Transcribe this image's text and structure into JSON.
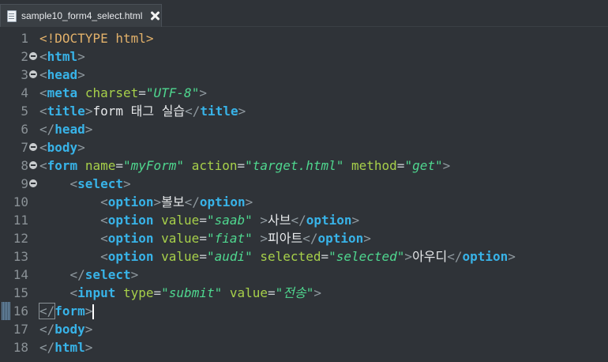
{
  "tab": {
    "filename": "sample10_form4_select.html",
    "icon": "html-file-icon",
    "close_icon": "close-icon"
  },
  "editor": {
    "current_line": 16,
    "folding_lines": [
      2,
      3,
      7,
      8,
      9
    ],
    "colors": {
      "background": "#2f3338",
      "tag": "#38b3e8",
      "attribute": "#a7d04a",
      "value": "#4fd78f",
      "doctype": "#e2b16a"
    },
    "lines": [
      {
        "number": "1",
        "tokens": [
          {
            "t": "decl",
            "v": "<!DOCTYPE html>"
          }
        ]
      },
      {
        "number": "2",
        "tokens": [
          {
            "t": "br",
            "v": "<"
          },
          {
            "t": "tag",
            "v": "html"
          },
          {
            "t": "br",
            "v": ">"
          }
        ]
      },
      {
        "number": "3",
        "tokens": [
          {
            "t": "br",
            "v": "<"
          },
          {
            "t": "tag",
            "v": "head"
          },
          {
            "t": "br",
            "v": ">"
          }
        ]
      },
      {
        "number": "4",
        "tokens": [
          {
            "t": "br",
            "v": "<"
          },
          {
            "t": "tag",
            "v": "meta"
          },
          {
            "t": "text",
            "v": " "
          },
          {
            "t": "attr",
            "v": "charset"
          },
          {
            "t": "eq",
            "v": "="
          },
          {
            "t": "val",
            "v": "\"UTF-8\""
          },
          {
            "t": "br",
            "v": ">"
          }
        ]
      },
      {
        "number": "5",
        "tokens": [
          {
            "t": "br",
            "v": "<"
          },
          {
            "t": "tag",
            "v": "title"
          },
          {
            "t": "br",
            "v": ">"
          },
          {
            "t": "text",
            "v": "form 태그 실습"
          },
          {
            "t": "br",
            "v": "</"
          },
          {
            "t": "tag",
            "v": "title"
          },
          {
            "t": "br",
            "v": ">"
          }
        ]
      },
      {
        "number": "6",
        "tokens": [
          {
            "t": "br",
            "v": "</"
          },
          {
            "t": "tag",
            "v": "head"
          },
          {
            "t": "br",
            "v": ">"
          }
        ]
      },
      {
        "number": "7",
        "tokens": [
          {
            "t": "br",
            "v": "<"
          },
          {
            "t": "tag",
            "v": "body"
          },
          {
            "t": "br",
            "v": ">"
          }
        ]
      },
      {
        "number": "8",
        "tokens": [
          {
            "t": "br",
            "v": "<"
          },
          {
            "t": "tag",
            "v": "form"
          },
          {
            "t": "text",
            "v": " "
          },
          {
            "t": "attr",
            "v": "name"
          },
          {
            "t": "eq",
            "v": "="
          },
          {
            "t": "val",
            "v": "\"myForm\""
          },
          {
            "t": "text",
            "v": " "
          },
          {
            "t": "attr",
            "v": "action"
          },
          {
            "t": "eq",
            "v": "="
          },
          {
            "t": "val",
            "v": "\"target.html\""
          },
          {
            "t": "text",
            "v": " "
          },
          {
            "t": "attr",
            "v": "method"
          },
          {
            "t": "eq",
            "v": "="
          },
          {
            "t": "val",
            "v": "\"get\""
          },
          {
            "t": "br",
            "v": ">"
          }
        ]
      },
      {
        "number": "9",
        "tokens": [
          {
            "t": "text",
            "v": "    "
          },
          {
            "t": "br",
            "v": "<"
          },
          {
            "t": "tag",
            "v": "select"
          },
          {
            "t": "br",
            "v": ">"
          }
        ]
      },
      {
        "number": "10",
        "tokens": [
          {
            "t": "text",
            "v": "        "
          },
          {
            "t": "br",
            "v": "<"
          },
          {
            "t": "tag",
            "v": "option"
          },
          {
            "t": "br",
            "v": ">"
          },
          {
            "t": "text",
            "v": "볼보"
          },
          {
            "t": "br",
            "v": "</"
          },
          {
            "t": "tag",
            "v": "option"
          },
          {
            "t": "br",
            "v": ">"
          }
        ]
      },
      {
        "number": "11",
        "tokens": [
          {
            "t": "text",
            "v": "        "
          },
          {
            "t": "br",
            "v": "<"
          },
          {
            "t": "tag",
            "v": "option"
          },
          {
            "t": "text",
            "v": " "
          },
          {
            "t": "attr",
            "v": "value"
          },
          {
            "t": "eq",
            "v": "="
          },
          {
            "t": "val",
            "v": "\"saab\""
          },
          {
            "t": "text",
            "v": " "
          },
          {
            "t": "br",
            "v": ">"
          },
          {
            "t": "text",
            "v": "사브"
          },
          {
            "t": "br",
            "v": "</"
          },
          {
            "t": "tag",
            "v": "option"
          },
          {
            "t": "br",
            "v": ">"
          }
        ]
      },
      {
        "number": "12",
        "tokens": [
          {
            "t": "text",
            "v": "        "
          },
          {
            "t": "br",
            "v": "<"
          },
          {
            "t": "tag",
            "v": "option"
          },
          {
            "t": "text",
            "v": " "
          },
          {
            "t": "attr",
            "v": "value"
          },
          {
            "t": "eq",
            "v": "="
          },
          {
            "t": "val",
            "v": "\"fiat\""
          },
          {
            "t": "text",
            "v": " "
          },
          {
            "t": "br",
            "v": ">"
          },
          {
            "t": "text",
            "v": "피아트"
          },
          {
            "t": "br",
            "v": "</"
          },
          {
            "t": "tag",
            "v": "option"
          },
          {
            "t": "br",
            "v": ">"
          }
        ]
      },
      {
        "number": "13",
        "tokens": [
          {
            "t": "text",
            "v": "        "
          },
          {
            "t": "br",
            "v": "<"
          },
          {
            "t": "tag",
            "v": "option"
          },
          {
            "t": "text",
            "v": " "
          },
          {
            "t": "attr",
            "v": "value"
          },
          {
            "t": "eq",
            "v": "="
          },
          {
            "t": "val",
            "v": "\"audi\""
          },
          {
            "t": "text",
            "v": " "
          },
          {
            "t": "attr",
            "v": "selected"
          },
          {
            "t": "eq",
            "v": "="
          },
          {
            "t": "val",
            "v": "\"selected\""
          },
          {
            "t": "br",
            "v": ">"
          },
          {
            "t": "text",
            "v": "아우디"
          },
          {
            "t": "br",
            "v": "</"
          },
          {
            "t": "tag",
            "v": "option"
          },
          {
            "t": "br",
            "v": ">"
          }
        ]
      },
      {
        "number": "14",
        "tokens": [
          {
            "t": "text",
            "v": "    "
          },
          {
            "t": "br",
            "v": "</"
          },
          {
            "t": "tag",
            "v": "select"
          },
          {
            "t": "br",
            "v": ">"
          }
        ]
      },
      {
        "number": "15",
        "tokens": [
          {
            "t": "text",
            "v": "    "
          },
          {
            "t": "br",
            "v": "<"
          },
          {
            "t": "tag",
            "v": "input"
          },
          {
            "t": "text",
            "v": " "
          },
          {
            "t": "attr",
            "v": "type"
          },
          {
            "t": "eq",
            "v": "="
          },
          {
            "t": "val",
            "v": "\"submit\""
          },
          {
            "t": "text",
            "v": " "
          },
          {
            "t": "attr",
            "v": "value"
          },
          {
            "t": "eq",
            "v": "="
          },
          {
            "t": "val",
            "v": "\"전송\""
          },
          {
            "t": "br",
            "v": ">"
          }
        ]
      },
      {
        "number": "16",
        "tokens": [
          {
            "t": "br",
            "v": "</"
          },
          {
            "t": "tag",
            "v": "form"
          },
          {
            "t": "br",
            "v": ">"
          }
        ]
      },
      {
        "number": "17",
        "tokens": [
          {
            "t": "br",
            "v": "</"
          },
          {
            "t": "tag",
            "v": "body"
          },
          {
            "t": "br",
            "v": ">"
          }
        ]
      },
      {
        "number": "18",
        "tokens": [
          {
            "t": "br",
            "v": "</"
          },
          {
            "t": "tag",
            "v": "html"
          },
          {
            "t": "br",
            "v": ">"
          }
        ]
      }
    ]
  }
}
